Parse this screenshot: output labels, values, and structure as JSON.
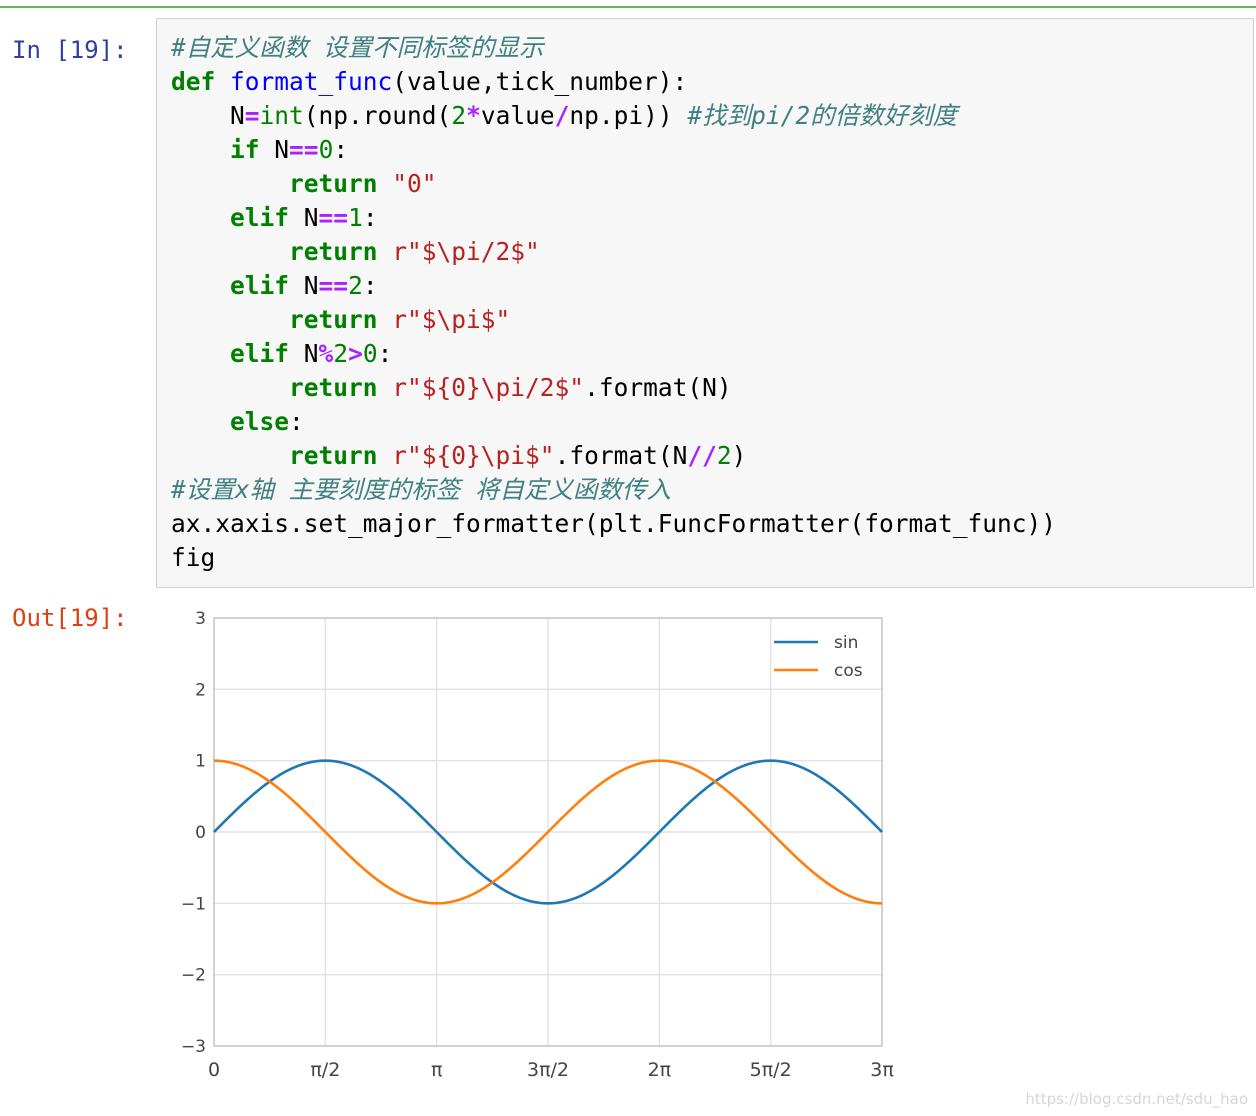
{
  "notebook": {
    "in_prompt": "In [19]:",
    "out_prompt": "Out[19]:",
    "code_lines": [
      [
        {
          "t": "#自定义函数 设置不同标签的显示",
          "c": "cm"
        }
      ],
      [
        {
          "t": "def",
          "c": "kw"
        },
        {
          "t": " ",
          "c": ""
        },
        {
          "t": "format_func",
          "c": "fn"
        },
        {
          "t": "(value,tick_number):",
          "c": ""
        }
      ],
      [
        {
          "t": "    N",
          "c": ""
        },
        {
          "t": "=",
          "c": "op"
        },
        {
          "t": "int",
          "c": "bi"
        },
        {
          "t": "(np.round(",
          "c": ""
        },
        {
          "t": "2",
          "c": "num"
        },
        {
          "t": "*",
          "c": "op"
        },
        {
          "t": "value",
          "c": ""
        },
        {
          "t": "/",
          "c": "op"
        },
        {
          "t": "np.pi)) ",
          "c": ""
        },
        {
          "t": "#找到pi/2的倍数好刻度",
          "c": "cm"
        }
      ],
      [
        {
          "t": "    ",
          "c": ""
        },
        {
          "t": "if",
          "c": "kw"
        },
        {
          "t": " N",
          "c": ""
        },
        {
          "t": "==",
          "c": "op"
        },
        {
          "t": "0",
          "c": "num"
        },
        {
          "t": ":",
          "c": ""
        }
      ],
      [
        {
          "t": "        ",
          "c": ""
        },
        {
          "t": "return",
          "c": "kw"
        },
        {
          "t": " ",
          "c": ""
        },
        {
          "t": "\"0\"",
          "c": "str"
        }
      ],
      [
        {
          "t": "    ",
          "c": ""
        },
        {
          "t": "elif",
          "c": "kw"
        },
        {
          "t": " N",
          "c": ""
        },
        {
          "t": "==",
          "c": "op"
        },
        {
          "t": "1",
          "c": "num"
        },
        {
          "t": ":",
          "c": ""
        }
      ],
      [
        {
          "t": "        ",
          "c": ""
        },
        {
          "t": "return",
          "c": "kw"
        },
        {
          "t": " ",
          "c": ""
        },
        {
          "t": "r\"$\\pi/2$\"",
          "c": "str"
        }
      ],
      [
        {
          "t": "    ",
          "c": ""
        },
        {
          "t": "elif",
          "c": "kw"
        },
        {
          "t": " N",
          "c": ""
        },
        {
          "t": "==",
          "c": "op"
        },
        {
          "t": "2",
          "c": "num"
        },
        {
          "t": ":",
          "c": ""
        }
      ],
      [
        {
          "t": "        ",
          "c": ""
        },
        {
          "t": "return",
          "c": "kw"
        },
        {
          "t": " ",
          "c": ""
        },
        {
          "t": "r\"$\\pi$\"",
          "c": "str"
        }
      ],
      [
        {
          "t": "    ",
          "c": ""
        },
        {
          "t": "elif",
          "c": "kw"
        },
        {
          "t": " N",
          "c": ""
        },
        {
          "t": "%",
          "c": "op"
        },
        {
          "t": "2",
          "c": "num"
        },
        {
          "t": ">",
          "c": "op"
        },
        {
          "t": "0",
          "c": "num"
        },
        {
          "t": ":",
          "c": ""
        }
      ],
      [
        {
          "t": "        ",
          "c": ""
        },
        {
          "t": "return",
          "c": "kw"
        },
        {
          "t": " ",
          "c": ""
        },
        {
          "t": "r\"${0}\\pi/2$\"",
          "c": "str"
        },
        {
          "t": ".format(N)",
          "c": ""
        }
      ],
      [
        {
          "t": "    ",
          "c": ""
        },
        {
          "t": "else",
          "c": "kw"
        },
        {
          "t": ":",
          "c": ""
        }
      ],
      [
        {
          "t": "        ",
          "c": ""
        },
        {
          "t": "return",
          "c": "kw"
        },
        {
          "t": " ",
          "c": ""
        },
        {
          "t": "r\"${0}\\pi$\"",
          "c": "str"
        },
        {
          "t": ".format(N",
          "c": ""
        },
        {
          "t": "//",
          "c": "op"
        },
        {
          "t": "2",
          "c": "num"
        },
        {
          "t": ")",
          "c": ""
        }
      ],
      [
        {
          "t": "#设置x轴 主要刻度的标签 将自定义函数传入",
          "c": "cm"
        }
      ],
      [
        {
          "t": "ax.xaxis.set_major_formatter(plt.FuncFormatter(format_func))",
          "c": ""
        }
      ],
      [
        {
          "t": "fig",
          "c": ""
        }
      ]
    ]
  },
  "chart_data": {
    "type": "line",
    "xlim": [
      0,
      9.42477796
    ],
    "ylim": [
      -3,
      3
    ],
    "grid": true,
    "legend_position": "upper-right",
    "xticks": [
      0,
      1.5707963,
      3.1415927,
      4.712389,
      6.2831853,
      7.8539816,
      9.424778
    ],
    "xtick_labels": [
      "0",
      "π/2",
      "π",
      "3π/2",
      "2π",
      "5π/2",
      "3π"
    ],
    "yticks": [
      3,
      2,
      1,
      0,
      -1,
      -2,
      -3
    ],
    "ytick_labels": [
      "3",
      "2",
      "1",
      "0",
      "−1",
      "−2",
      "−3"
    ],
    "series": [
      {
        "name": "sin",
        "function": "sin",
        "color": "#1f77b4"
      },
      {
        "name": "cos",
        "function": "cos",
        "color": "#ff7f0e"
      }
    ]
  },
  "watermark": "https://blog.csdn.net/sdu_hao"
}
